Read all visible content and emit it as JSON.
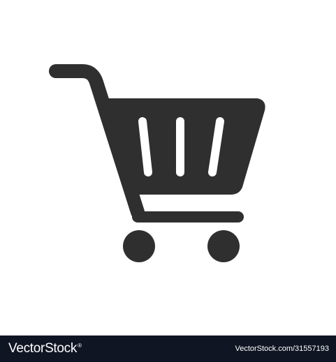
{
  "icon": {
    "name": "shopping-cart-icon",
    "color": "#2f2f2f"
  },
  "footer": {
    "background": "#0f1523",
    "text_color": "#ffffff",
    "brand": "VectorStock",
    "brand_mark": "®",
    "image_ref": "VectorStock.com/31557193"
  }
}
